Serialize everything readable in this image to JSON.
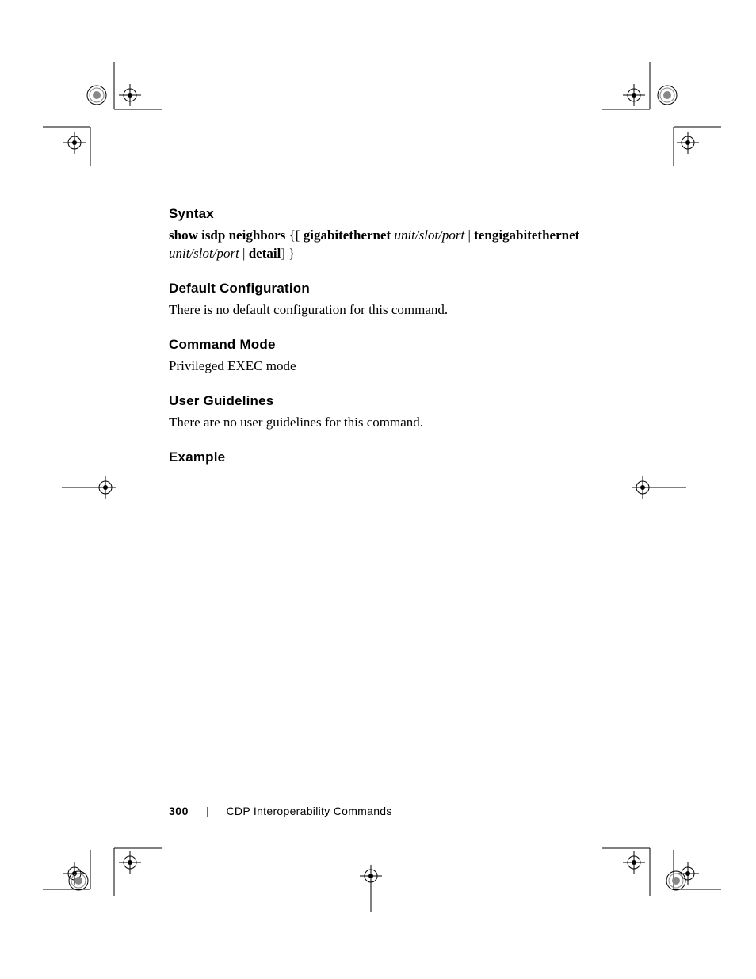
{
  "sections": {
    "syntax": {
      "heading": "Syntax",
      "parts": [
        {
          "t": "show isdp neighbors",
          "cls": "bold"
        },
        {
          "t": " {[ ",
          "cls": "plain"
        },
        {
          "t": "gigabitethernet",
          "cls": "bold"
        },
        {
          "t": " ",
          "cls": "plain"
        },
        {
          "t": "unit/slot/port",
          "cls": "ital"
        },
        {
          "t": " | ",
          "cls": "plain"
        },
        {
          "t": "tengigabitethernet",
          "cls": "bold"
        },
        {
          "t": " ",
          "cls": "plain"
        },
        {
          "t": "unit/slot/port",
          "cls": "ital"
        },
        {
          "t": " | ",
          "cls": "plain"
        },
        {
          "t": "detail",
          "cls": "bold"
        },
        {
          "t": "] }",
          "cls": "plain"
        }
      ]
    },
    "default_cfg": {
      "heading": "Default Configuration",
      "body": "There is no default configuration for this command."
    },
    "cmd_mode": {
      "heading": "Command Mode",
      "body": "Privileged EXEC mode"
    },
    "user_guidelines": {
      "heading": "User Guidelines",
      "body": "There are no user guidelines for this command."
    },
    "example": {
      "heading": "Example"
    }
  },
  "footer": {
    "page_number": "300",
    "separator": "|",
    "chapter": "CDP Interoperability Commands"
  }
}
